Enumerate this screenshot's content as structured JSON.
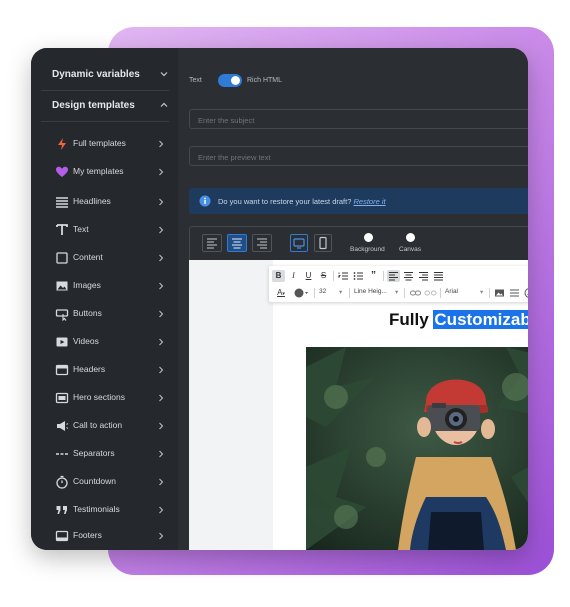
{
  "sidebar": {
    "dynamic_variables": "Dynamic variables",
    "design_templates": "Design templates",
    "items": [
      {
        "label": "Full templates",
        "icon": "lightning-icon"
      },
      {
        "label": "My templates",
        "icon": "heart-icon"
      },
      {
        "label": "Headlines",
        "icon": "headlines-icon"
      },
      {
        "label": "Text",
        "icon": "text-icon"
      },
      {
        "label": "Content",
        "icon": "content-icon"
      },
      {
        "label": "Images",
        "icon": "image-icon"
      },
      {
        "label": "Buttons",
        "icon": "button-icon"
      },
      {
        "label": "Videos",
        "icon": "video-icon"
      },
      {
        "label": "Headers",
        "icon": "header-icon"
      },
      {
        "label": "Hero sections",
        "icon": "hero-icon"
      },
      {
        "label": "Call to action",
        "icon": "megaphone-icon"
      },
      {
        "label": "Separators",
        "icon": "separator-icon"
      },
      {
        "label": "Countdown",
        "icon": "timer-icon"
      },
      {
        "label": "Testimonials",
        "icon": "quote-icon"
      },
      {
        "label": "Footers",
        "icon": "footer-icon"
      }
    ]
  },
  "format": {
    "text_label": "Text",
    "rich_label": "Rich HTML",
    "rich_enabled": true
  },
  "subject": {
    "placeholder": "Enter the subject",
    "value": ""
  },
  "preview": {
    "placeholder": "Enter the preview text",
    "value": ""
  },
  "alert": {
    "message": "Do you want to restore your latest draft?",
    "link": "Restore it"
  },
  "toolbar": {
    "background_label": "Background",
    "canvas_label": "Canvas"
  },
  "rte": {
    "font_size": "32",
    "line_height": "Line Heig...",
    "font": "Arial"
  },
  "headline": {
    "plain": "Fully",
    "highlighted": "Customizable"
  },
  "colors": {
    "accent": "#2f7bd6",
    "sidebar_bg": "#25282c",
    "main_bg": "#2b2e33",
    "gradient_start": "#e1b7f2",
    "gradient_end": "#9b4fd6"
  }
}
